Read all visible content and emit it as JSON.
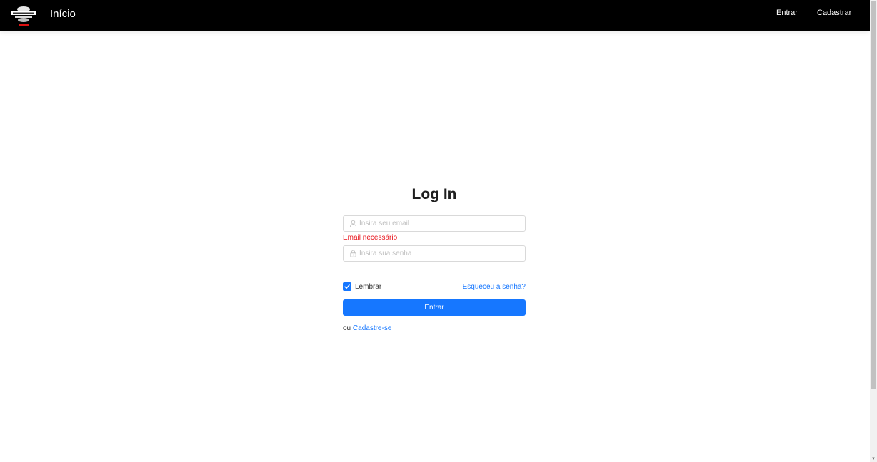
{
  "header": {
    "brand": "Início",
    "nav": {
      "login_label": "Entrar",
      "register_label": "Cadastrar"
    }
  },
  "form": {
    "title": "Log In",
    "email": {
      "placeholder": "Insira seu email",
      "value": "",
      "error": "Email necessário",
      "icon": "user-icon"
    },
    "password": {
      "placeholder": "Insira sua senha",
      "value": "",
      "icon": "lock-icon"
    },
    "remember": {
      "label": "Lembrar",
      "checked": true
    },
    "forgot_label": "Esqueceu a senha?",
    "submit_label": "Entrar",
    "alt_prefix": "ou",
    "alt_link": "Cadastre-se"
  },
  "colors": {
    "header_bg": "#000000",
    "accent": "#1677ff",
    "error": "#e8121a"
  }
}
